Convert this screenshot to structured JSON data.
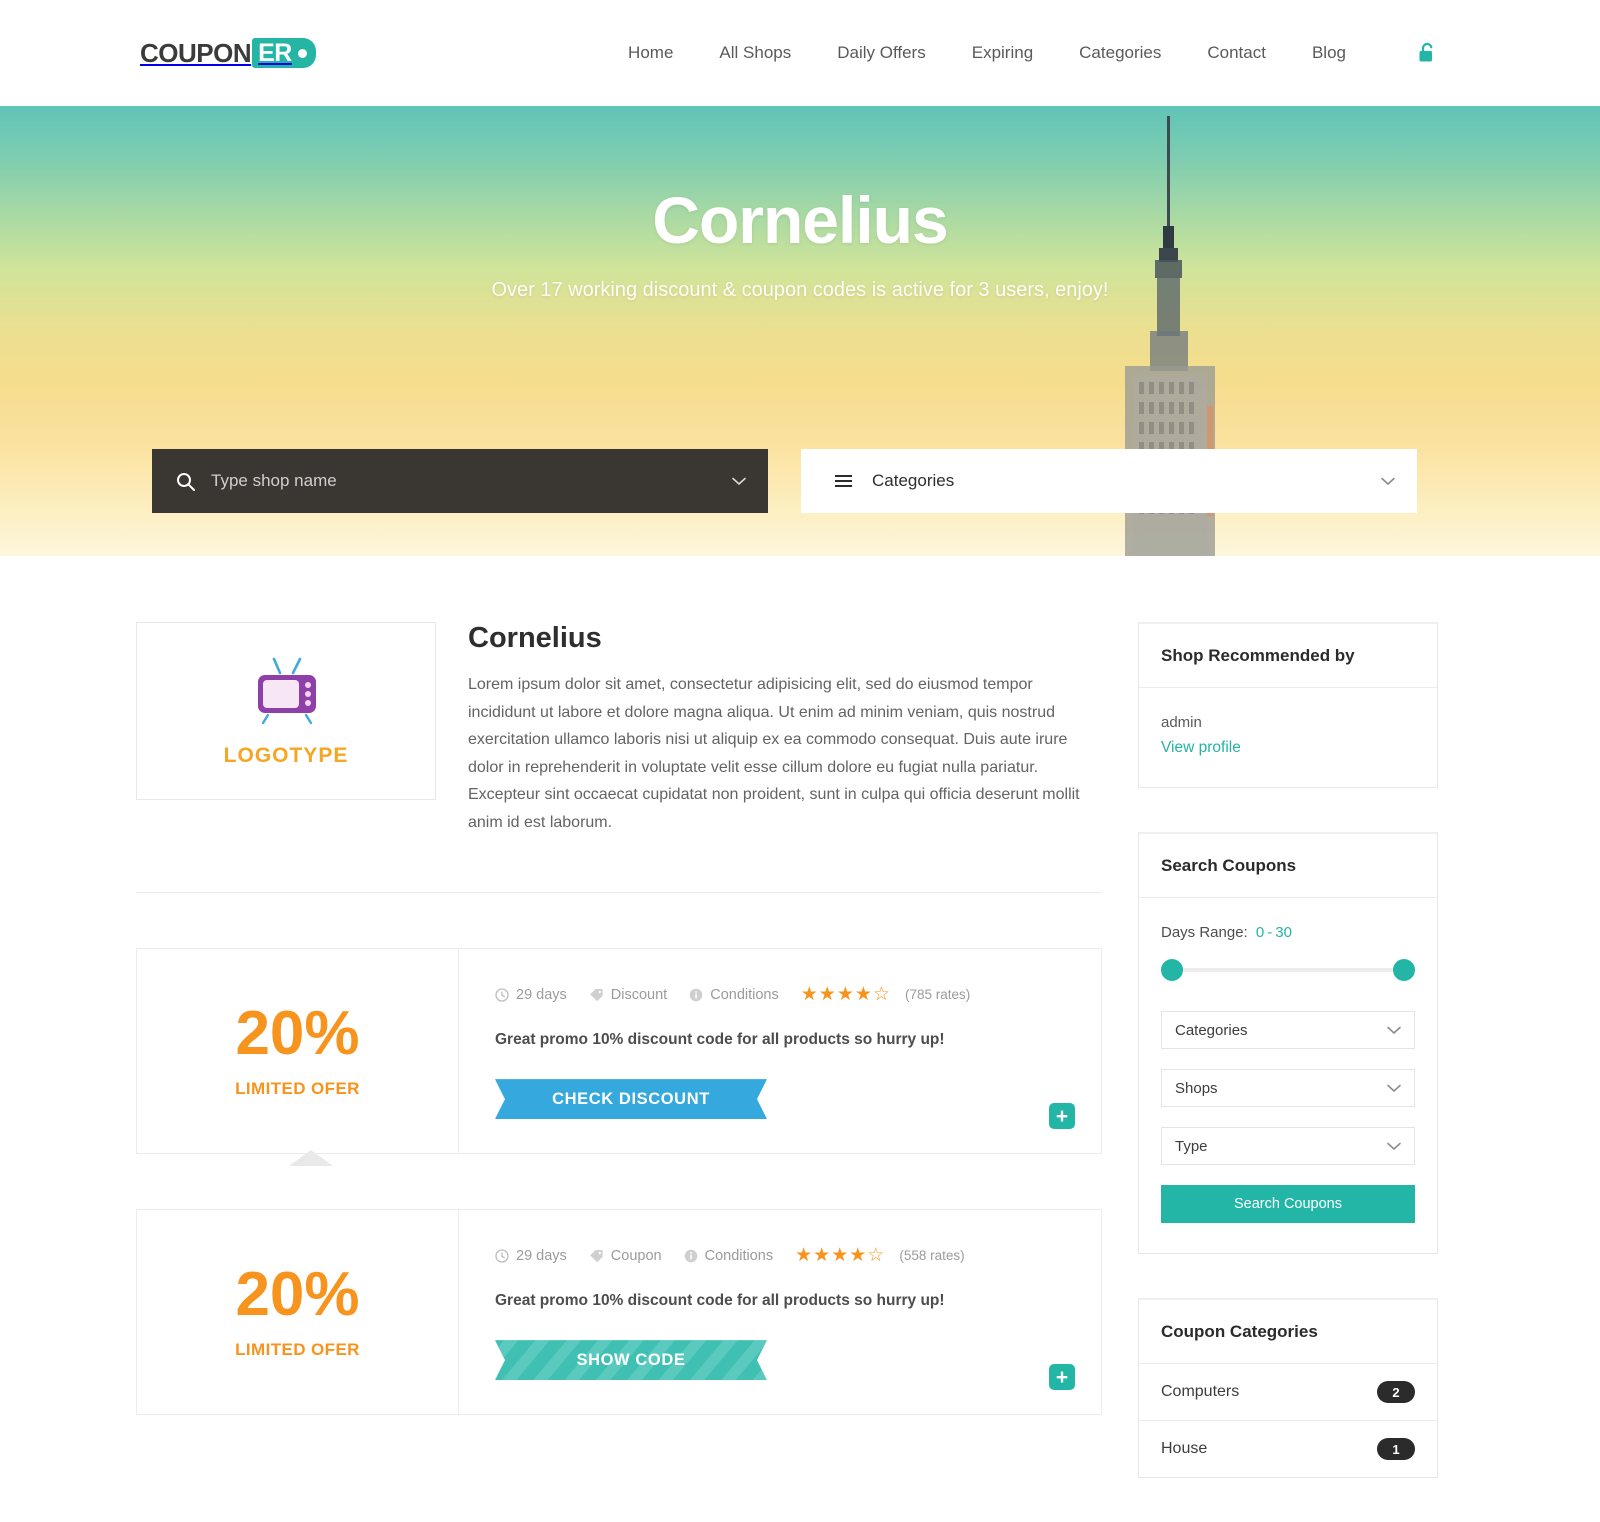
{
  "header": {
    "logo": {
      "main": "COUPON",
      "tag": "ER"
    },
    "nav": [
      {
        "label": "Home"
      },
      {
        "label": "All Shops"
      },
      {
        "label": "Daily Offers"
      },
      {
        "label": "Expiring"
      },
      {
        "label": "Categories"
      },
      {
        "label": "Contact"
      },
      {
        "label": "Blog"
      }
    ],
    "lock_icon": "unlock-icon"
  },
  "hero": {
    "title": "Cornelius",
    "subtitle": "Over 17 working discount & coupon codes is active for 3 users, enjoy!",
    "search": {
      "icon": "search-icon",
      "placeholder": "Type shop name",
      "value": "",
      "chevron": "chevron-down-icon"
    },
    "categories": {
      "icon": "hamburger-icon",
      "label": "Categories",
      "chevron": "chevron-down-icon"
    }
  },
  "shop": {
    "logo_text": "LOGOTYPE",
    "logo_icon": "tv-icon",
    "title": "Cornelius",
    "description": "Lorem ipsum dolor sit amet, consectetur adipisicing elit, sed do eiusmod tempor incididunt ut labore et dolore magna aliqua. Ut enim ad minim veniam, quis nostrud exercitation ullamco laboris nisi ut aliquip ex ea commodo consequat. Duis aute irure dolor in reprehenderit in voluptate velit esse cillum dolore eu fugiat nulla pariatur. Excepteur sint occaecat cupidatat non proident, sunt in culpa qui officia deserunt mollit anim id est laborum."
  },
  "coupons": [
    {
      "percent": "20%",
      "limited_label": "LIMITED OFER",
      "days": "29 days",
      "type": "Discount",
      "conditions": "Conditions",
      "rating": 4,
      "rates": "(785 rates)",
      "promo": "Great promo 10% discount code for all products so hurry up!",
      "button_label": "CHECK DISCOUNT",
      "button_style": "check",
      "plus_label": "+"
    },
    {
      "percent": "20%",
      "limited_label": "LIMITED OFER",
      "days": "29 days",
      "type": "Coupon",
      "conditions": "Conditions",
      "rating": 4,
      "rates": "(558 rates)",
      "promo": "Great promo 10% discount code for all products so hurry up!",
      "button_label": "SHOW CODE",
      "button_style": "show",
      "plus_label": "+"
    }
  ],
  "sidebar": {
    "recommended": {
      "title": "Shop Recommended by",
      "user": "admin",
      "link": "View profile"
    },
    "search_coupons": {
      "title": "Search Coupons",
      "days_label": "Days Range:",
      "days_min": "0",
      "days_sep": "-",
      "days_max": "30",
      "selects": [
        {
          "label": "Categories"
        },
        {
          "label": "Shops"
        },
        {
          "label": "Type"
        }
      ],
      "button_label": "Search Coupons"
    },
    "coupon_categories": {
      "title": "Coupon Categories",
      "items": [
        {
          "label": "Computers",
          "count": "2"
        },
        {
          "label": "House",
          "count": "1"
        }
      ]
    }
  },
  "colors": {
    "teal": "#23b5a6",
    "orange": "#f7941e",
    "blue": "#35a8dd",
    "dark": "#3a3732"
  }
}
